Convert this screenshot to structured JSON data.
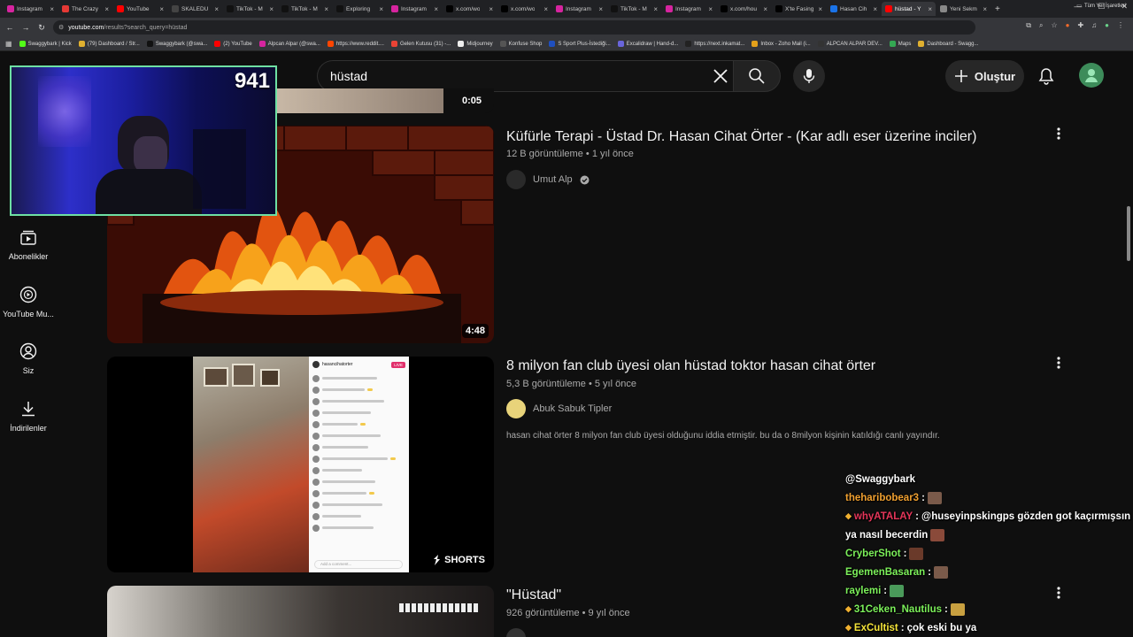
{
  "browser": {
    "tabs": [
      {
        "title": "Instagram",
        "color": "#d6249f"
      },
      {
        "title": "The Crazy",
        "color": "#e53935"
      },
      {
        "title": "YouTube",
        "color": "#ff0000"
      },
      {
        "title": "SKALEDU",
        "color": "#444444"
      },
      {
        "title": "TikTok - M",
        "color": "#111111"
      },
      {
        "title": "TikTok - M",
        "color": "#111111"
      },
      {
        "title": "Exploring",
        "color": "#111111"
      },
      {
        "title": "Instagram",
        "color": "#d6249f"
      },
      {
        "title": "x.com/wo",
        "color": "#000000"
      },
      {
        "title": "x.com/wo",
        "color": "#000000"
      },
      {
        "title": "Instagram",
        "color": "#d6249f"
      },
      {
        "title": "TikTok - M",
        "color": "#111111"
      },
      {
        "title": "Instagram",
        "color": "#d6249f"
      },
      {
        "title": "x.com/hou",
        "color": "#000000"
      },
      {
        "title": "X'te Fasing",
        "color": "#000000"
      },
      {
        "title": "Hasan Cih",
        "color": "#1a73e8"
      },
      {
        "title": "hüstad - Y",
        "color": "#ff0000",
        "active": true
      },
      {
        "title": "Yeni Sekm",
        "color": "#888888"
      }
    ],
    "url_host": "youtube.com",
    "url_path": "/results?search_query=hüstad",
    "bookmarks": [
      {
        "label": "Swaggybark | Kick",
        "color": "#53fc18"
      },
      {
        "label": "(79) Dashboard / Str...",
        "color": "#e0b030"
      },
      {
        "label": "Swaggybark (@swa...",
        "color": "#111111"
      },
      {
        "label": "(2) YouTube",
        "color": "#ff0000"
      },
      {
        "label": "Alpcan Alpar (@swa...",
        "color": "#d6249f"
      },
      {
        "label": "https://www.reddit....",
        "color": "#ff4500"
      },
      {
        "label": "Gelen Kutusu (31) -...",
        "color": "#ea4335"
      },
      {
        "label": "Midjourney",
        "color": "#eeeeee"
      },
      {
        "label": "Konfuse Shop",
        "color": "#555555"
      },
      {
        "label": "S Sport Plus-İstediği...",
        "color": "#1f4fbf"
      },
      {
        "label": "Excalidraw | Hand-d...",
        "color": "#6965db"
      },
      {
        "label": "https://next.inkamat...",
        "color": "#222222"
      },
      {
        "label": "Inbox - Zoho Mail (i...",
        "color": "#e4a11b"
      },
      {
        "label": "ALPCAN ALPAR DEV...",
        "color": "#333333"
      },
      {
        "label": "Maps",
        "color": "#34a853"
      },
      {
        "label": "Dashboard - Swagg...",
        "color": "#e0b030"
      }
    ],
    "all_bookmarks": "Tüm Yer İşaretleri"
  },
  "youtube": {
    "search_query": "hüstad",
    "create_label": "Oluştur",
    "sidebar": [
      {
        "label": "Abonelikler",
        "icon": "subscriptions-icon"
      },
      {
        "label": "YouTube Mu...",
        "icon": "youtube-music-icon"
      },
      {
        "label": "Siz",
        "icon": "you-icon"
      },
      {
        "label": "İndirilenler",
        "icon": "downloads-icon"
      }
    ],
    "results": [
      {
        "duration": "0:05"
      },
      {
        "title": "Küfürle Terapi - Üstad Dr. Hasan Cihat Örter - (Kar adlı eser üzerine inciler)",
        "views": "12 B görüntüleme",
        "age": "1 yıl önce",
        "channel": "Umut Alp",
        "verified": true,
        "duration": "4:48"
      },
      {
        "title": "8 milyon fan club üyesi olan hüstad toktor hasan cihat örter",
        "views": "5,3 B görüntüleme",
        "age": "5 yıl önce",
        "channel": "Abuk Sabuk Tipler",
        "description": "hasan cihat örter 8 milyon fan club üyesi olduğunu iddia etmiştir. bu da o 8milyon kişinin katıldığı canlı yayındır.",
        "badge": "SHORTS",
        "insta_username": "hasancihatorter",
        "insta_live": "LIVE",
        "insta_comment_placeholder": "Add a comment..."
      },
      {
        "title": "\"Hüstad\"",
        "views": "926 görüntüleme",
        "age": "9 yıl önce"
      }
    ]
  },
  "stream_overlay": {
    "viewer_count": "941",
    "chat": [
      {
        "user": "",
        "text": "@Swaggybark",
        "user_color": "#ffffff"
      },
      {
        "user": "theharibobear3",
        "text": "",
        "user_color": "#f0a030",
        "emote": true
      },
      {
        "user": "whyATALAY",
        "text": "@huseyinpskingps gözden got kaçırmışsın",
        "user_color": "#e5365a",
        "badge": true
      },
      {
        "user": "",
        "text": "ya nasıl becerdin",
        "user_color": "#ffffff",
        "emote": true
      },
      {
        "user": "CryberShot",
        "text": "",
        "user_color": "#7cf05a",
        "emote": true
      },
      {
        "user": "EgemenBasaran",
        "text": "",
        "user_color": "#7cf05a",
        "emote": true
      },
      {
        "user": "raylemi",
        "text": "",
        "user_color": "#7cf05a",
        "emote": true
      },
      {
        "user": "31Ceken_Nautilus",
        "text": "",
        "user_color": "#7cf05a",
        "badge": true,
        "emote": true
      },
      {
        "user": "ExCultist",
        "text": "çok eski bu ya",
        "user_color": "#f5e43a",
        "badge": true
      }
    ]
  },
  "colors": {
    "background": "#0f0f0f",
    "webcam_border": "#6ee0a3",
    "text_secondary": "#aaaaaa"
  }
}
